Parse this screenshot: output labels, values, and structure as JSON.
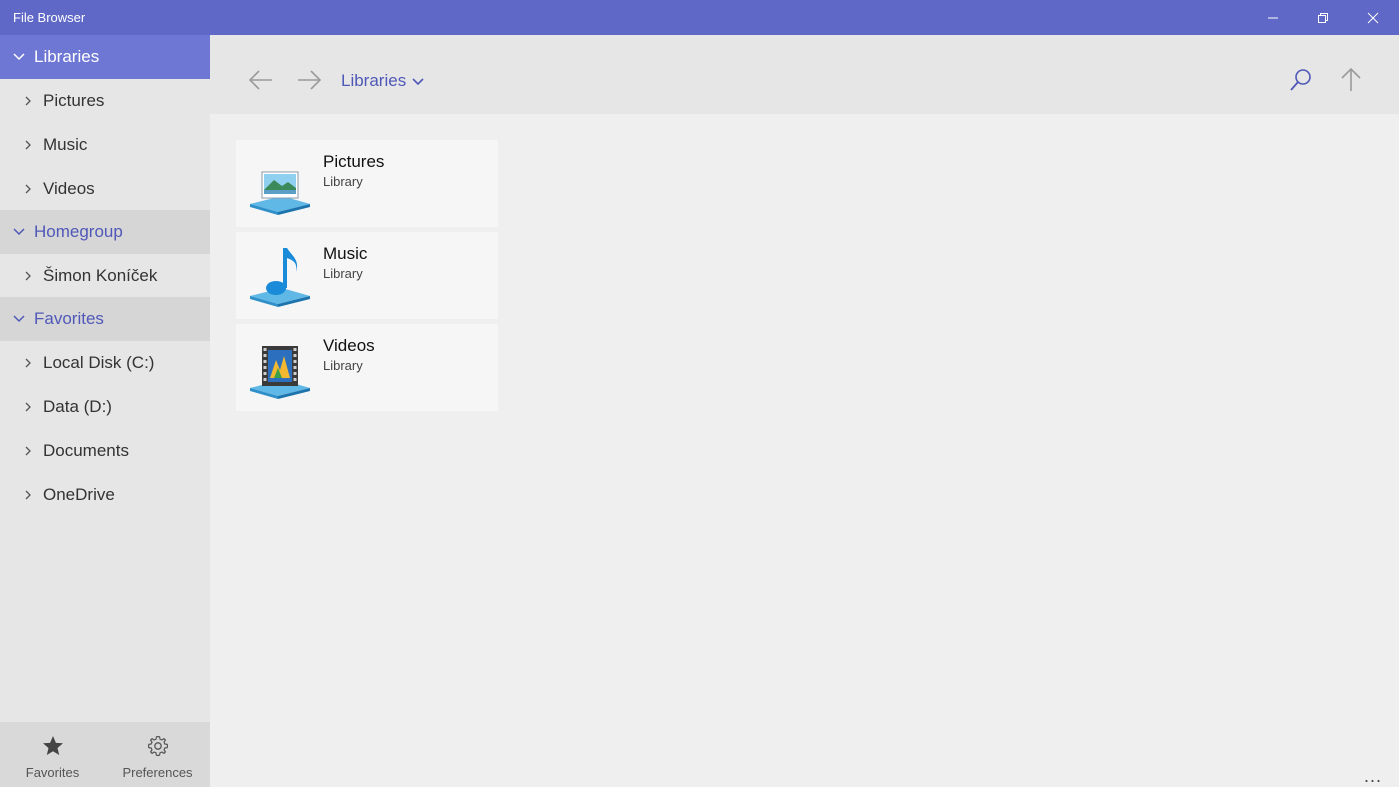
{
  "window": {
    "title": "File Browser"
  },
  "sidebar": {
    "groups": [
      {
        "label": "Libraries",
        "active": true,
        "items": [
          "Pictures",
          "Music",
          "Videos"
        ]
      },
      {
        "label": "Homegroup",
        "active": false,
        "items": [
          "Šimon Koníček"
        ]
      },
      {
        "label": "Favorites",
        "active": false,
        "items": [
          "Local Disk (C:)",
          "Data (D:)",
          "Documents",
          "OneDrive"
        ]
      }
    ],
    "footer": {
      "favorites_label": "Favorites",
      "preferences_label": "Preferences"
    }
  },
  "toolbar": {
    "path_label": "Libraries"
  },
  "content": {
    "tiles": [
      {
        "name": "Pictures",
        "kind": "Library",
        "icon": "pictures-library-icon"
      },
      {
        "name": "Music",
        "kind": "Library",
        "icon": "music-library-icon"
      },
      {
        "name": "Videos",
        "kind": "Library",
        "icon": "videos-library-icon"
      }
    ],
    "more_label": "..."
  },
  "colors": {
    "accent": "#5f68c6",
    "accent_active": "#6e78d4",
    "link_text": "#4f58b8"
  }
}
